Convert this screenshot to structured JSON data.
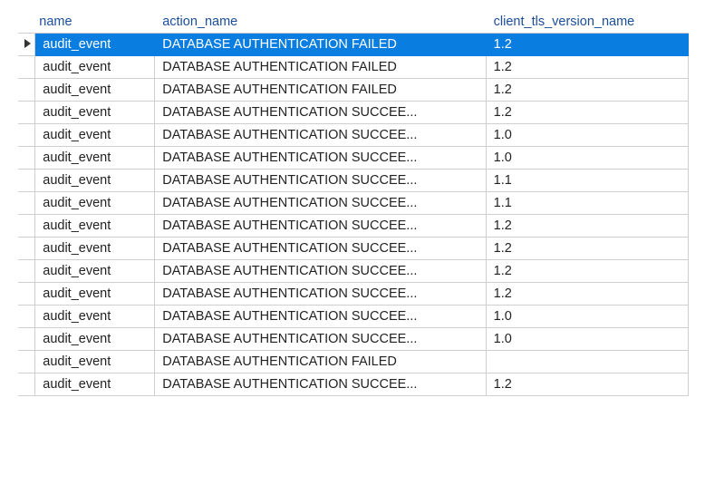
{
  "columns": {
    "name": "name",
    "action": "action_name",
    "tls": "client_tls_version_name"
  },
  "selected_index": 0,
  "rows": [
    {
      "name": "audit_event",
      "action": "DATABASE AUTHENTICATION FAILED",
      "tls": "1.2"
    },
    {
      "name": "audit_event",
      "action": "DATABASE AUTHENTICATION FAILED",
      "tls": "1.2"
    },
    {
      "name": "audit_event",
      "action": "DATABASE AUTHENTICATION FAILED",
      "tls": "1.2"
    },
    {
      "name": "audit_event",
      "action": "DATABASE AUTHENTICATION SUCCEE...",
      "tls": "1.2"
    },
    {
      "name": "audit_event",
      "action": "DATABASE AUTHENTICATION SUCCEE...",
      "tls": "1.0"
    },
    {
      "name": "audit_event",
      "action": "DATABASE AUTHENTICATION SUCCEE...",
      "tls": "1.0"
    },
    {
      "name": "audit_event",
      "action": "DATABASE AUTHENTICATION SUCCEE...",
      "tls": "1.1"
    },
    {
      "name": "audit_event",
      "action": "DATABASE AUTHENTICATION SUCCEE...",
      "tls": "1.1"
    },
    {
      "name": "audit_event",
      "action": "DATABASE AUTHENTICATION SUCCEE...",
      "tls": "1.2"
    },
    {
      "name": "audit_event",
      "action": "DATABASE AUTHENTICATION SUCCEE...",
      "tls": "1.2"
    },
    {
      "name": "audit_event",
      "action": "DATABASE AUTHENTICATION SUCCEE...",
      "tls": "1.2"
    },
    {
      "name": "audit_event",
      "action": "DATABASE AUTHENTICATION SUCCEE...",
      "tls": "1.2"
    },
    {
      "name": "audit_event",
      "action": "DATABASE AUTHENTICATION SUCCEE...",
      "tls": "1.0"
    },
    {
      "name": "audit_event",
      "action": "DATABASE AUTHENTICATION SUCCEE...",
      "tls": "1.0"
    },
    {
      "name": "audit_event",
      "action": "DATABASE AUTHENTICATION FAILED",
      "tls": ""
    },
    {
      "name": "audit_event",
      "action": "DATABASE AUTHENTICATION SUCCEE...",
      "tls": "1.2"
    }
  ]
}
